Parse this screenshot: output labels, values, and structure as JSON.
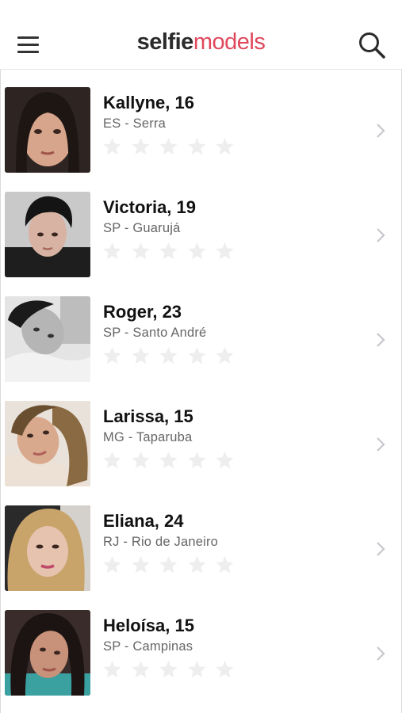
{
  "app": {
    "logo_part1": "selfie",
    "logo_part2": "models"
  },
  "colors": {
    "brand_pink": "#e0485c",
    "logo_dark": "#2b2b2b",
    "star_empty": "#eeeeee",
    "chevron": "#c7c7cc"
  },
  "icons": {
    "menu": "hamburger-menu-icon",
    "search": "search-icon",
    "star": "star-icon",
    "chevron": "chevron-right-icon"
  },
  "models": [
    {
      "name": "Kallyne, 16",
      "location": "ES - Serra",
      "rating": 0
    },
    {
      "name": "Victoria, 19",
      "location": "SP - Guarujá",
      "rating": 0
    },
    {
      "name": "Roger, 23",
      "location": "SP - Santo André",
      "rating": 0
    },
    {
      "name": "Larissa, 15",
      "location": "MG - Taparuba",
      "rating": 0
    },
    {
      "name": "Eliana, 24",
      "location": "RJ - Rio de Janeiro",
      "rating": 0
    },
    {
      "name": "Heloísa, 15",
      "location": "SP - Campinas",
      "rating": 0
    }
  ]
}
